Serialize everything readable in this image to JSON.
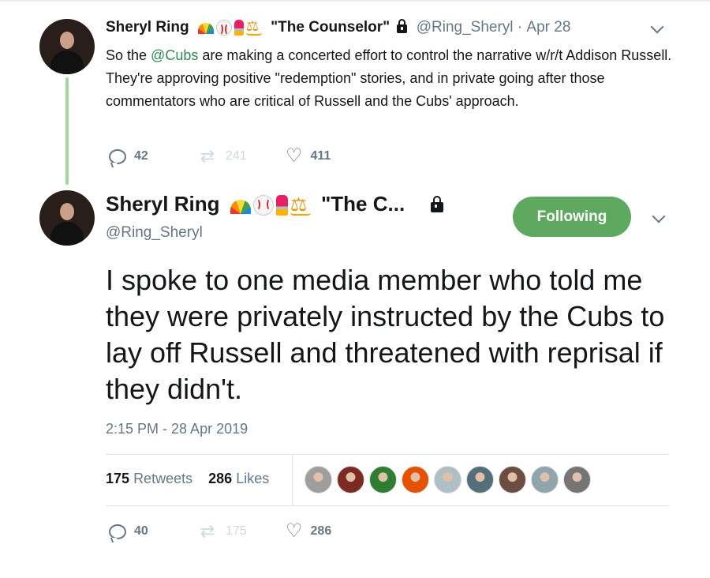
{
  "tweet1": {
    "name": "Sheryl Ring",
    "display_suffix": "\"The Counselor\"",
    "handle": "@Ring_Sheryl",
    "separator": "·",
    "date": "Apr 28",
    "text_before": "So the ",
    "mention": "@Cubs",
    "text_after": " are making a concerted effort to control the narrative w/r/t Addison Russell. They're approving positive \"redemption\" stories, and in private going after those commentators who are critical of Russell and the Cubs' approach.",
    "replies": "42",
    "retweets": "241",
    "likes": "411"
  },
  "tweet2": {
    "name": "Sheryl Ring",
    "display_suffix": "\"The C...",
    "handle": "@Ring_Sheryl",
    "follow_label": "Following",
    "text": "I spoke to one media member who told me they were privately instructed by the Cubs to lay off Russell and threatened with reprisal if they didn't.",
    "timestamp": "2:15 PM - 28 Apr 2019",
    "retweet_count": "175",
    "retweet_label": "Retweets",
    "like_count": "286",
    "like_label": "Likes",
    "replies": "40",
    "retweets": "175",
    "likes": "286"
  },
  "icons": [
    "reply-icon",
    "retweet-icon",
    "heart-icon",
    "lock-icon",
    "chevron-down-icon"
  ],
  "colors": {
    "accent": "#5fa860",
    "mention": "#2e8b57",
    "thread_line": "#a5d6a0",
    "muted": "#657786"
  },
  "likers": [
    {
      "name": "liker-1",
      "color": "#9e9e9e"
    },
    {
      "name": "liker-2",
      "color": "#7b2b22"
    },
    {
      "name": "liker-3",
      "color": "#2e7d32"
    },
    {
      "name": "liker-4",
      "color": "#e65100"
    },
    {
      "name": "liker-5",
      "color": "#b0bec5"
    },
    {
      "name": "liker-6",
      "color": "#546e7a"
    },
    {
      "name": "liker-7",
      "color": "#6d4c41"
    },
    {
      "name": "liker-8",
      "color": "#90a4ae"
    },
    {
      "name": "liker-9",
      "color": "#757575"
    }
  ]
}
